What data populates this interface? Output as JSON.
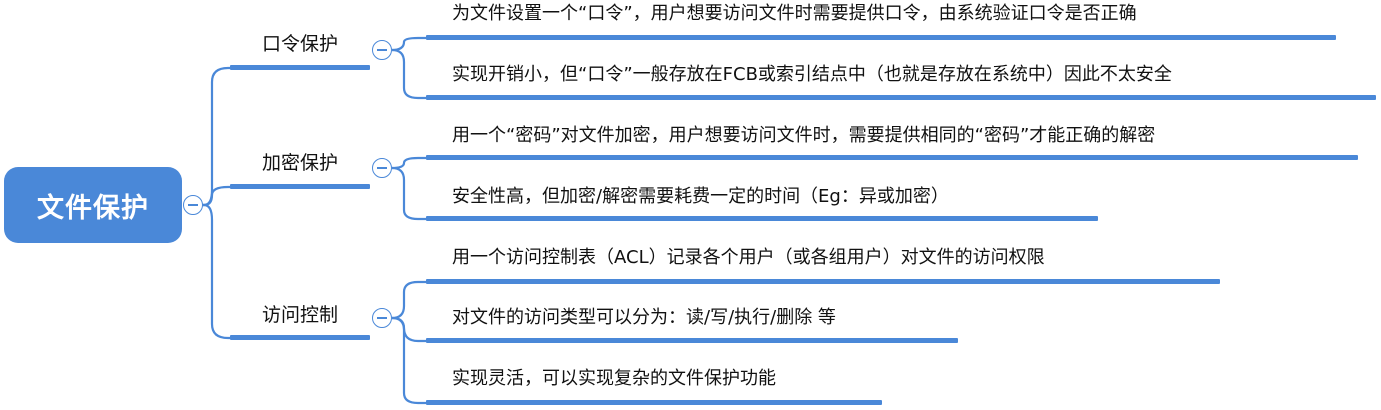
{
  "mindmap": {
    "root": {
      "label": "文件保护"
    },
    "branches": [
      {
        "label": "口令保护",
        "children": [
          {
            "label": "为文件设置一个“口令”，用户想要访问文件时需要提供口令，由系统验证口令是否正确"
          },
          {
            "label": "实现开销小，但“口令”一般存放在FCB或索引结点中（也就是存放在系统中）因此不太安全"
          }
        ]
      },
      {
        "label": "加密保护",
        "children": [
          {
            "label": "用一个“密码”对文件加密，用户想要访问文件时，需要提供相同的“密码”才能正确的解密"
          },
          {
            "label": "安全性高，但加密/解密需要耗费一定的时间（Eg：异或加密）"
          }
        ]
      },
      {
        "label": "访问控制",
        "children": [
          {
            "label": "用一个访问控制表（ACL）记录各个用户（或各组用户）对文件的访问权限"
          },
          {
            "label": "对文件的访问类型可以分为：读/写/执行/删除 等"
          },
          {
            "label": "实现灵活，可以实现复杂的文件保护功能"
          }
        ]
      }
    ],
    "colors": {
      "accent": "#4a88d8",
      "text": "#111111",
      "background": "#ffffff"
    },
    "icons": {
      "collapse": "collapse-icon"
    }
  }
}
